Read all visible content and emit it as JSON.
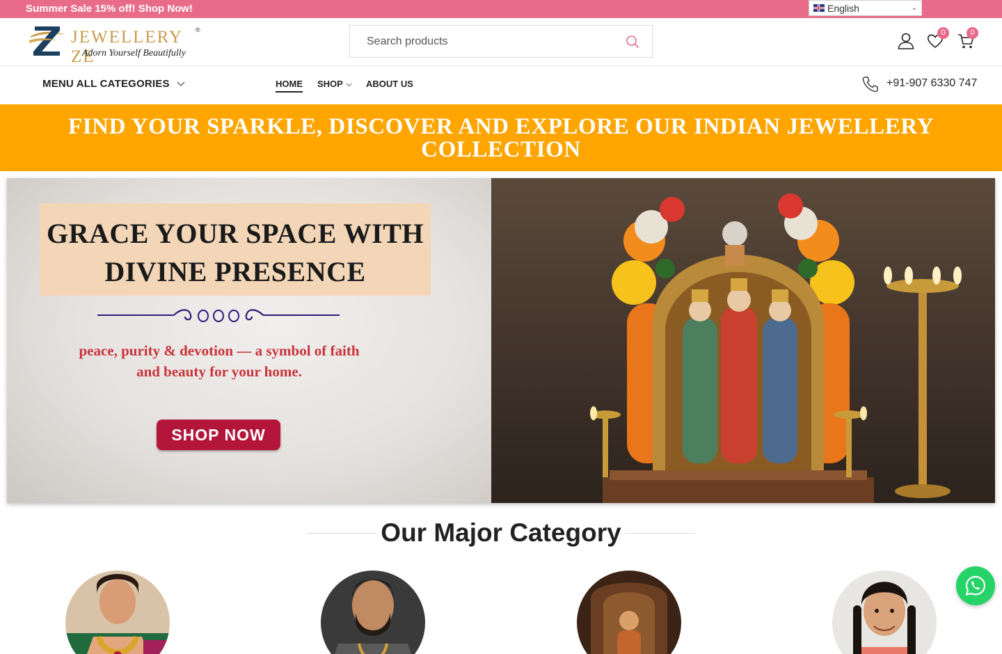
{
  "promo": {
    "text": "Summer Sale 15% off! Shop Now!"
  },
  "language": {
    "selected": "English"
  },
  "brand": {
    "name": "JEWELLERY ZE",
    "reg": "®",
    "tagline": "Adorn Yourself Beautifully"
  },
  "search": {
    "placeholder": "Search products"
  },
  "header_icons": {
    "wishlist_count": "0",
    "cart_count": "0"
  },
  "nav": {
    "menu_all": "MENU ALL CATEGORIES",
    "links": [
      {
        "label": "HOME",
        "active": true
      },
      {
        "label": "SHOP"
      },
      {
        "label": "ABOUT US"
      }
    ],
    "phone": "+91-907 6330 747"
  },
  "banner": {
    "text": "FIND YOUR SPARKLE, DISCOVER AND EXPLORE OUR INDIAN JEWELLERY COLLECTION"
  },
  "hero": {
    "title_line1": "GRACE YOUR SPACE WITH",
    "title_line2": "DIVINE PRESENCE",
    "subtitle_line1": "peace, purity & devotion — a symbol of faith",
    "subtitle_line2": "and beauty for your home.",
    "button": "SHOP NOW"
  },
  "categories": {
    "heading": "Our Major Category",
    "items": [
      {
        "icon": "woman-necklace-image"
      },
      {
        "icon": "man-chain-image"
      },
      {
        "icon": "idol-image"
      },
      {
        "icon": "girl-image"
      }
    ]
  },
  "colors": {
    "promo": "#e86c8a",
    "banner": "#ffa500",
    "hero_button": "#b3163a",
    "whatsapp": "#25d366"
  }
}
